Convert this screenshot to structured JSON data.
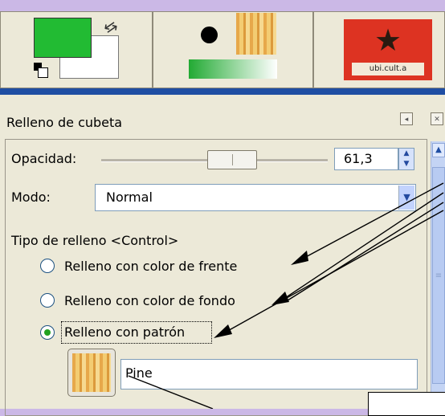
{
  "top_strip": {
    "fg_color": "#22bb33",
    "bg_color": "#ffffff",
    "swap_icon": "swap-arrows-icon",
    "default_colors_icon": "default-colors-icon",
    "image_label": "ubi.cult.a"
  },
  "dock": {
    "title": "Relleno de cubeta",
    "configure_icon": "tab-menu-icon",
    "close_icon": "close-icon"
  },
  "options": {
    "opacity_label": "Opacidad:",
    "opacity_value": "61,3",
    "opacity_level": 61.3,
    "mode_label": "Modo:",
    "mode_value": "Normal",
    "fill_type_label": "Tipo de relleno  <Control>",
    "fill_options": [
      {
        "label": "Relleno con color de frente",
        "selected": false
      },
      {
        "label": "Relleno con color de fondo",
        "selected": false
      },
      {
        "label": "Relleno con patrón",
        "selected": true
      }
    ],
    "pattern_name": "Pine"
  },
  "accent_colors": {
    "selection_bar": "#1f4ea3",
    "background": "#cbb8e6",
    "radio_dot": "#21a121"
  }
}
